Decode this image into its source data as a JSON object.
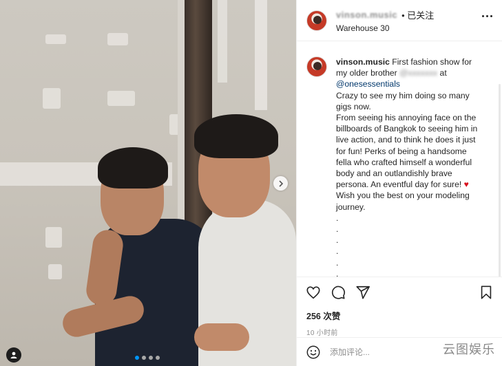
{
  "post": {
    "username_blurred": "vinson.music",
    "follow_label": "• 已关注",
    "location": "Warehouse 30",
    "more_icon": "more-horizontal-icon"
  },
  "caption": {
    "username": "vinson.music",
    "line_intro": " First fashion show for my older brother ",
    "mention_blurred": "@xxxxxxx",
    "at_word": " at",
    "mention_brand": "@onesessentials",
    "p1": "Crazy to see my him doing so many gigs now.",
    "p2_a": "From seeing his annoying face on the billboards of Bangkok to seeing him in live action, and to think he does it just for fun! Perks of being a handsome fella who crafted himself a wonderful body and an outlandishly brave persona. An eventful day for sure! ",
    "heart": "♥",
    "p2_b": " Wish you the best on your modeling journey.",
    "dots": [
      ".",
      ".",
      ".",
      ".",
      ".",
      ".",
      "."
    ]
  },
  "actions": {
    "like_icon": "heart-outline-icon",
    "comment_icon": "comment-icon",
    "share_icon": "paper-plane-icon",
    "save_icon": "bookmark-icon"
  },
  "likes_label": "256 次赞",
  "timestamp": "10 小时前",
  "comment": {
    "placeholder": "添加评论..."
  },
  "watermark": "云图娱乐",
  "carousel": {
    "count": 4,
    "active_index": 0
  },
  "colors": {
    "link": "#00376b",
    "accent_dot": "#0095f6",
    "heart": "#d8111e"
  }
}
